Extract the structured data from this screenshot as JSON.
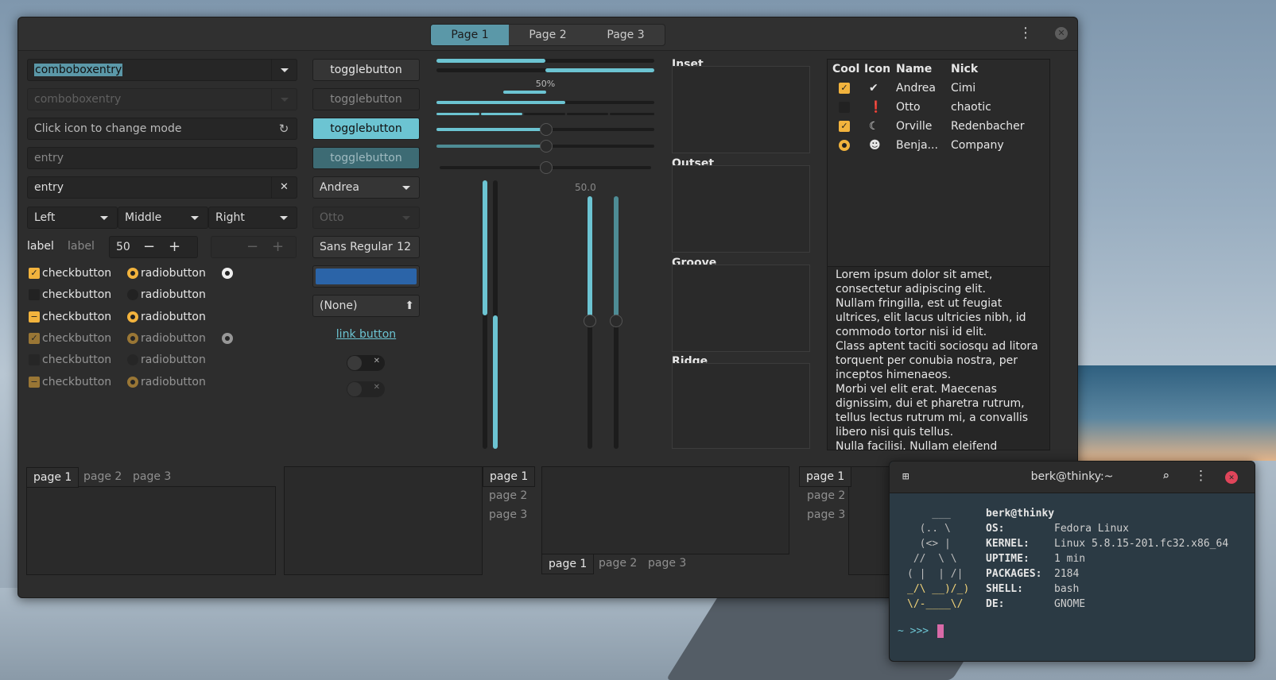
{
  "header": {
    "tabs": [
      "Page 1",
      "Page 2",
      "Page 3"
    ]
  },
  "entries": {
    "combo1": "comboboxentry",
    "combo2": "comboboxentry",
    "mode_placeholder": "Click icon to change mode",
    "entry1": "entry",
    "entry2": "entry"
  },
  "seg": [
    "Left",
    "Middle",
    "Right"
  ],
  "spin": {
    "label1": "label",
    "label2": "label",
    "value": "50"
  },
  "checks": [
    "checkbutton",
    "checkbutton",
    "checkbutton",
    "checkbutton",
    "checkbutton",
    "checkbutton"
  ],
  "radios": [
    "radiobutton",
    "radiobutton",
    "radiobutton",
    "radiobutton",
    "radiobutton",
    "radiobutton"
  ],
  "toggles": [
    "togglebutton",
    "togglebutton",
    "togglebutton",
    "togglebutton"
  ],
  "combo": {
    "value": "Andrea",
    "disabled_value": "Otto"
  },
  "font": {
    "name": "Sans Regular",
    "size": "12"
  },
  "color": {
    "value": "#2b64a8"
  },
  "file": {
    "value": "(None)"
  },
  "link": "link button",
  "progress": {
    "label": "50%",
    "value": 0.5
  },
  "scale": {
    "value_label": "50.0"
  },
  "frames": [
    "Inset",
    "Outset",
    "Groove",
    "Ridge"
  ],
  "tree": {
    "cols": [
      "Cool",
      "Icon",
      "Name",
      "Nick"
    ],
    "rows": [
      {
        "name": "Andrea",
        "nick": "Cimi",
        "icon": "check-circle-icon",
        "cool": "checked"
      },
      {
        "name": "Otto",
        "nick": "chaotic",
        "icon": "alert-icon",
        "cool": "unchecked"
      },
      {
        "name": "Orville",
        "nick": "Redenbacher",
        "icon": "moon-icon",
        "cool": "checked"
      },
      {
        "name": "Benja...",
        "nick": "Company",
        "icon": "bug-icon",
        "cool": "radio"
      }
    ]
  },
  "text": [
    "Lorem ipsum dolor sit amet,",
    "consectetur adipiscing elit.",
    "Nullam fringilla, est ut feugiat",
    "ultrices, elit lacus ultricies nibh, id",
    "commodo tortor nisi id elit.",
    "Class aptent taciti sociosqu ad litora",
    "torquent per conubia nostra, per",
    "inceptos himenaeos.",
    "Morbi vel elit erat. Maecenas",
    "dignissim, dui et pharetra rutrum,",
    "tellus lectus rutrum mi, a convallis",
    "libero nisi quis tellus.",
    "Nulla facilisi. Nullam eleifend lobortis"
  ],
  "notebooks": [
    "page 1",
    "page 2",
    "page 3"
  ],
  "terminal": {
    "title": "berk@thinky:~",
    "user": "berk@thinky",
    "fields": [
      [
        "OS:",
        "Fedora Linux"
      ],
      [
        "KERNEL:",
        "Linux 5.8.15-201.fc32.x86_64"
      ],
      [
        "UPTIME:",
        "1 min"
      ],
      [
        "PACKAGES:",
        "2184"
      ],
      [
        "SHELL:",
        "bash"
      ],
      [
        "DE:",
        "GNOME"
      ]
    ],
    "art": [
      "    ___",
      "  (.. \\",
      "  (<> |",
      " //  \\ \\",
      "( |  | /|",
      "_/\\ __)/_)",
      "\\/-____\\/"
    ],
    "prompt": "~ >>> ",
    "colors": {
      "label": "#e6e6e6",
      "value": "#cfcfcf",
      "prompt": "#6cc4d2",
      "cursor": "#d96aa8",
      "art": "#f2d479"
    }
  }
}
